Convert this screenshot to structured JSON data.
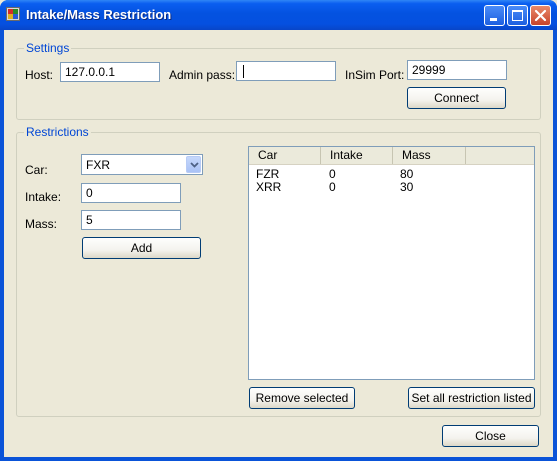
{
  "window": {
    "title": "Intake/Mass Restriction"
  },
  "settings": {
    "legend": "Settings",
    "host_label": "Host:",
    "host_value": "127.0.0.1",
    "admin_pass_label": "Admin pass:",
    "admin_pass_value": "",
    "insim_port_label": "InSim Port:",
    "insim_port_value": "29999",
    "connect_label": "Connect"
  },
  "restrictions": {
    "legend": "Restrictions",
    "car_label": "Car:",
    "car_selected": "FXR",
    "intake_label": "Intake:",
    "intake_value": "0",
    "mass_label": "Mass:",
    "mass_value": "5",
    "add_label": "Add",
    "list": {
      "columns": [
        "Car",
        "Intake",
        "Mass"
      ],
      "rows": [
        [
          "FZR",
          "0",
          "80"
        ],
        [
          "XRR",
          "0",
          "30"
        ]
      ]
    },
    "remove_selected_label": "Remove selected",
    "set_all_label": "Set all restriction listed"
  },
  "footer": {
    "close_label": "Close"
  },
  "colors": {
    "title_bar": "#0a5ef0",
    "group_legend": "#0046d5",
    "background": "#ece9d8"
  },
  "icons": [
    "app-icon",
    "minimize-icon",
    "maximize-icon",
    "close-icon",
    "chevron-down-icon"
  ]
}
